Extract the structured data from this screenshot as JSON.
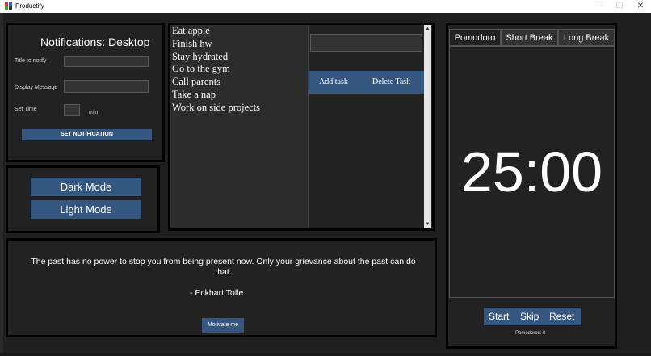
{
  "window": {
    "title": "Productify",
    "controls": {
      "minimize": "—",
      "maximize": "☐",
      "close": "✕"
    }
  },
  "notifications": {
    "title": "Notifications: Desktop",
    "title_label": "Title to notify",
    "message_label": "Display Message",
    "time_label": "Set Time",
    "time_unit": "min",
    "set_button": "SET NOTIFICATION",
    "title_value": "",
    "message_value": "",
    "time_value": ""
  },
  "modes": {
    "dark": "Dark Mode",
    "light": "Light Mode"
  },
  "tasks": {
    "items": [
      "Eat apple",
      "Finish hw",
      "Stay hydrated",
      "Go to the gym",
      "Call parents",
      "Take a nap",
      "Work on side projects"
    ],
    "entry_value": "",
    "add_button": "Add task",
    "delete_button": "Delete Task"
  },
  "quote": {
    "text": "The past has no power to stop you from being present now. Only your grievance about the past can do that.",
    "author": "-    Eckhart Tolle",
    "button": "Motivate me"
  },
  "pomodoro": {
    "tabs": [
      "Pomodoro",
      "Short Break",
      "Long Break"
    ],
    "active_tab": "Pomodoro",
    "time": "25:00",
    "buttons": {
      "start": "Start",
      "skip": "Skip",
      "reset": "Reset"
    },
    "count": "Pomodoros: 0"
  },
  "colors": {
    "accent": "#34567f",
    "background": "#1f1f1f",
    "panel_border": "#000000"
  }
}
